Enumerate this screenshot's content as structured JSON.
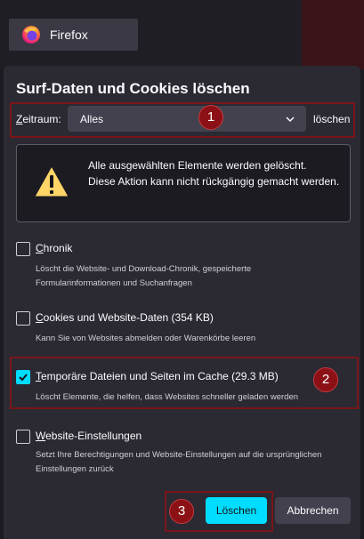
{
  "browser": {
    "tab_label": "Firefox"
  },
  "dialog": {
    "title": "Surf-Daten und Cookies löschen",
    "range": {
      "label_first": "Z",
      "label_rest": "eitraum:",
      "value": "Alles",
      "suffix": "löschen"
    },
    "warning": {
      "line1": "Alle ausgewählten Elemente werden gelöscht.",
      "line2": "Diese Aktion kann nicht rückgängig gemacht werden."
    },
    "options": [
      {
        "label_first": "C",
        "label_rest": "hronik",
        "checked": false,
        "description": "Löscht die Website- und Download-Chronik, gespeicherte Formularinformationen und Suchanfragen"
      },
      {
        "label_first": "",
        "label_ul": "C",
        "label_rest": "ookies und Website-Daten (354 KB)",
        "checked": false,
        "description": "Kann Sie von Websites abmelden oder Warenkörbe leeren"
      },
      {
        "label_first": "T",
        "label_rest": "emporäre Dateien und Seiten im Cache (29.3 MB)",
        "checked": true,
        "description": "Löscht Elemente, die helfen, dass Websites schneller geladen werden"
      },
      {
        "label_first": "W",
        "label_rest": "ebsite-Einstellungen",
        "checked": false,
        "description": "Setzt Ihre Berechtigungen und Website-Einstellungen auf die ursprünglichen Einstellungen zurück"
      }
    ],
    "buttons": {
      "clear": "Löschen",
      "cancel": "Abbrechen"
    }
  },
  "annotations": {
    "badge1": "1",
    "badge2": "2",
    "badge3": "3"
  },
  "colors": {
    "accent": "#00ddff",
    "annotation": "#8b1116",
    "dialog_bg": "#2b2a33"
  }
}
